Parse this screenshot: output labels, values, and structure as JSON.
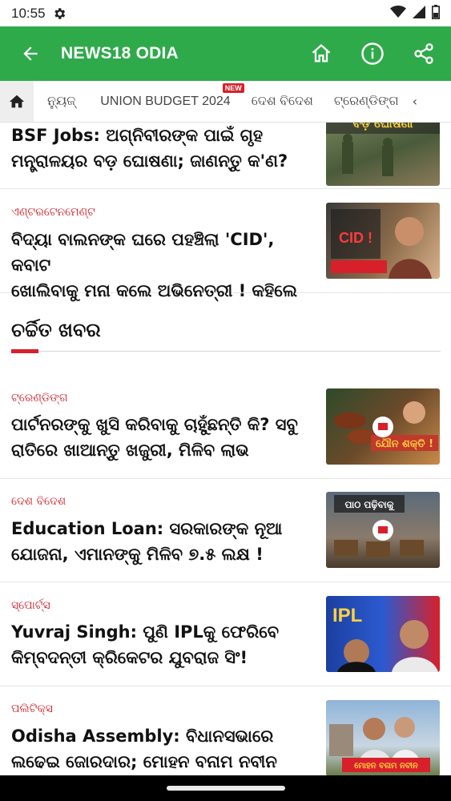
{
  "status": {
    "time": "10:55"
  },
  "appbar": {
    "title": "NEWS18 ODIA"
  },
  "tabs": {
    "items": [
      {
        "label": "ନ୍ୟୁଜ୍"
      },
      {
        "label": "UNION BUDGET 2024",
        "badge": "NEW"
      },
      {
        "label": "ଦେଶ ବିଦେଶ"
      },
      {
        "label": "ଟ୍ରେଣ୍ଡିଙ୍ଗ"
      }
    ],
    "more": "‹"
  },
  "articles_top": [
    {
      "category": "",
      "headline_line1": "BSF Jobs: ଅଗ୍ନିବୀରଙ୍କ ପାଇଁ ଗୃହ",
      "headline_line2": "ମନ୍ତ୍ରାଳୟର ବଡ଼ ଘୋଷଣା; ଜାଣନ୍ତୁ କ'ଣ?",
      "thumb_text": "ବଡ଼ ଘୋଷଣା"
    },
    {
      "category": "ଏଣ୍ଟରଟେନମେଣ୍ଟ",
      "headline_line1": "ବିଦ୍ୟା ବାଲନଙ୍କ ଘରେ ପହଞ୍ଚିଲା 'CID', କବାଟ",
      "headline_line2": "ଖୋଲିବାକୁ ମନା କଲେ ଅଭିନେତ୍ରୀ ! କହିଲେ",
      "thumb_text": "CID !"
    }
  ],
  "section": {
    "title": "ଚର୍ଚ୍ଚିତ ଖବର"
  },
  "articles": [
    {
      "category": "ଟ୍ରେଣ୍ଡିଙ୍ଗ",
      "headline_line1": "ପାର୍ଟନରଙ୍କୁ ଖୁସି କରିବାକୁ ଚାହୁଁଛନ୍ତି କି? ସବୁ",
      "headline_line2": "ରାତିରେ ଖାଆନ୍ତୁ ଖଜୁରୀ, ମିଳିବ ଲାଭ",
      "thumb_text": "ଯୌନ ଶକ୍ତି !"
    },
    {
      "category": "ଦେଶ ବିଦେଶ",
      "headline_line1": "Education Loan: ସରକାରଙ୍କ ନୂଆ",
      "headline_line2": "ଯୋଜନା, ଏମାନଙ୍କୁ ମିଳିବ ୭.୫ ଲକ୍ଷ !",
      "thumb_text": "ପାଠ ପଢ଼ିବାକୁ"
    },
    {
      "category": "ସ୍ପୋର୍ଟ୍ସ",
      "headline_line1": "Yuvraj Singh: ପୁଣି IPLକୁ ଫେରିବେ",
      "headline_line2": "କିମ୍ବଦନ୍ତୀ କ୍ରିକେଟର ଯୁବରାଜ ସିଂ!",
      "thumb_text": "IPL"
    },
    {
      "category": "ପଲିଟିକ୍ସ",
      "headline_line1": "Odisha Assembly: ବିଧାନସଭାରେ",
      "headline_line2": "ଲଢେଇ ଜୋରଦାର; ମୋହନ ବନାମ ନବୀନ",
      "thumb_text": "ମୋହନ ବନାମ ନବୀନ"
    }
  ],
  "colors": {
    "brand_green": "#2eaa4a",
    "accent_red": "#d8202a"
  }
}
